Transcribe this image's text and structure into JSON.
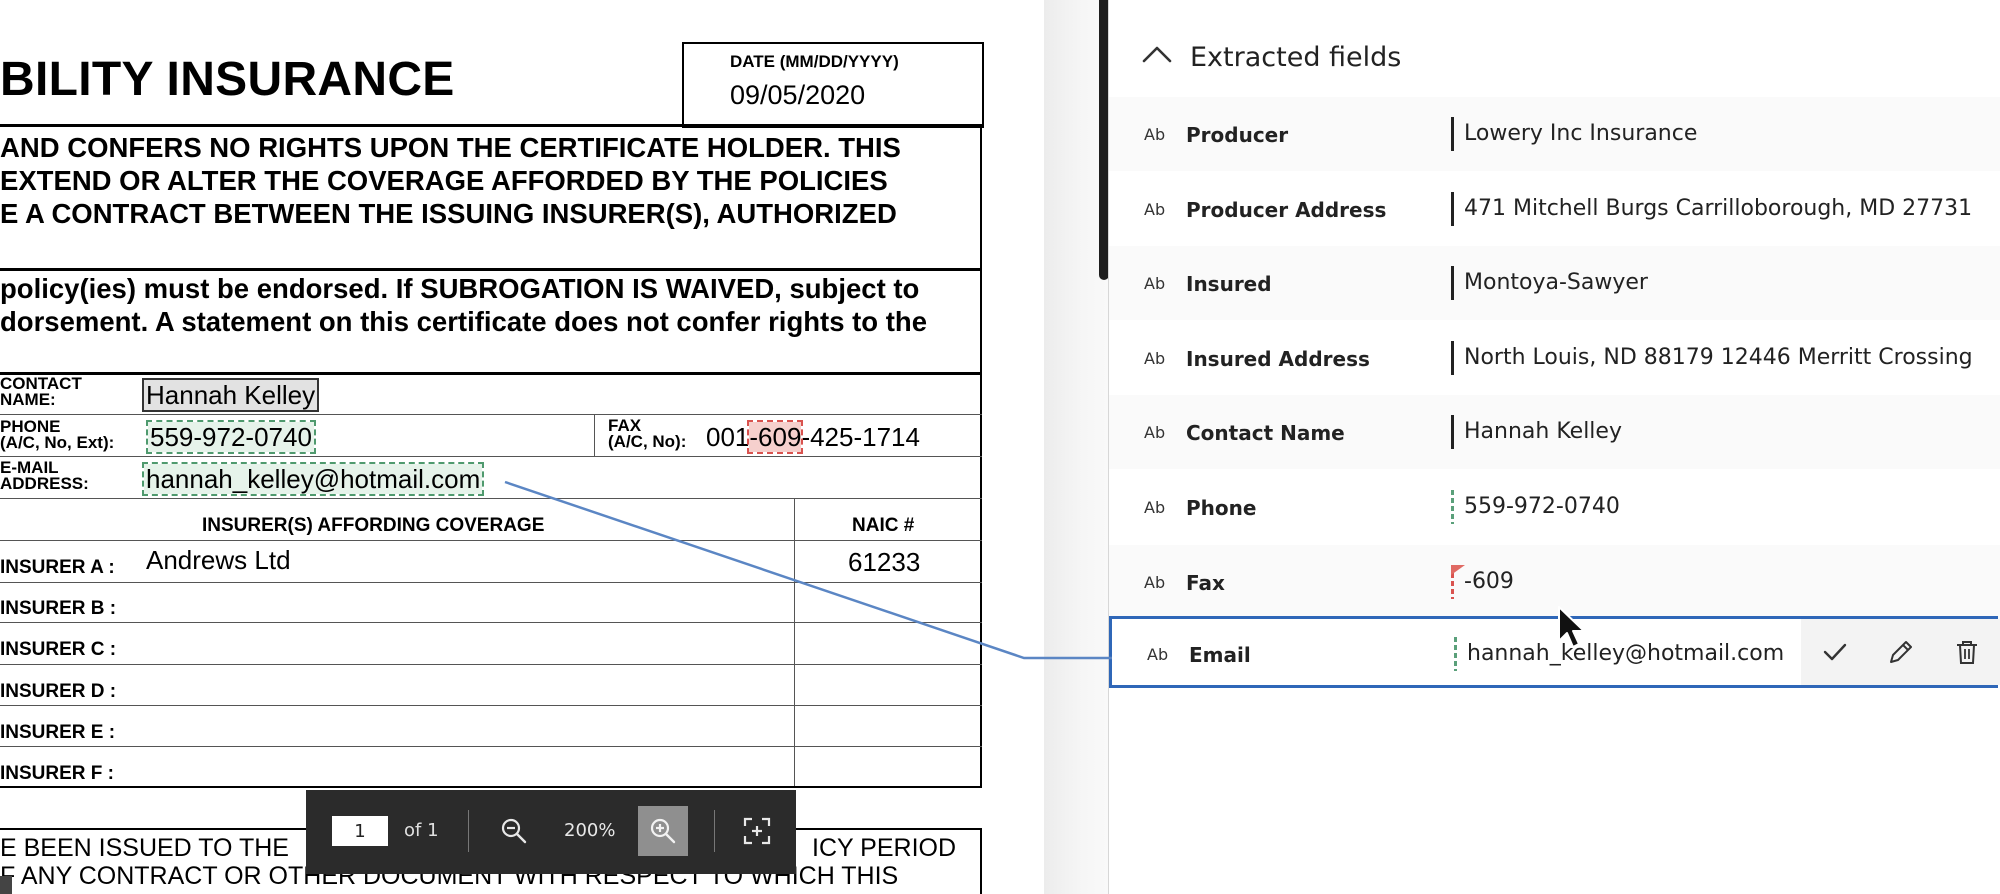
{
  "document": {
    "title": "BILITY INSURANCE",
    "date_label": "DATE (MM/DD/YYYY)",
    "date_value": "09/05/2020",
    "disclaimer_lines": [
      "AND CONFERS NO RIGHTS UPON THE CERTIFICATE HOLDER. THIS",
      "EXTEND OR ALTER THE COVERAGE AFFORDED BY THE POLICIES",
      "E A CONTRACT BETWEEN THE ISSUING INSURER(S), AUTHORIZED"
    ],
    "subrogation_lines": [
      "policy(ies) must be endorsed.  If SUBROGATION IS WAIVED, subject to",
      "dorsement.  A statement on this certificate does not confer rights to the"
    ],
    "contact_label_1": "CONTACT",
    "contact_label_2": "NAME:",
    "contact_value": "Hannah Kelley",
    "phone_label_1": "PHONE",
    "phone_label_2": "(A/C, No, Ext):",
    "phone_value": "559-972-0740",
    "fax_label_1": "FAX",
    "fax_label_2": "(A/C, No):",
    "fax_prefix": "001",
    "fax_highlight": "-609",
    "fax_suffix": "-425-1714",
    "email_label_1": "E-MAIL",
    "email_label_2": "ADDRESS:",
    "email_value": "hannah_kelley@hotmail.com",
    "insurers_header": "INSURER(S) AFFORDING COVERAGE",
    "naic_header": "NAIC #",
    "insurers": [
      {
        "label": "INSURER A :",
        "name": "Andrews Ltd",
        "naic": "61233"
      },
      {
        "label": "INSURER B :",
        "name": "",
        "naic": ""
      },
      {
        "label": "INSURER C :",
        "name": "",
        "naic": ""
      },
      {
        "label": "INSURER D :",
        "name": "",
        "naic": ""
      },
      {
        "label": "INSURER E :",
        "name": "",
        "naic": ""
      },
      {
        "label": "INSURER F :",
        "name": "",
        "naic": ""
      }
    ],
    "bottom_lines": [
      "E BEEN ISSUED TO THE",
      "ICY PERIOD",
      "F ANY CONTRACT OR OTHER DOCUMENT WITH RESPECT TO WHICH THIS"
    ]
  },
  "toolbar": {
    "page_number": "1",
    "page_of": "of 1",
    "zoom_level": "200%",
    "icons": [
      "zoom-out-icon",
      "zoom-in-icon",
      "fit-to-page-icon"
    ]
  },
  "panel": {
    "title": "Extracted fields",
    "type_label": "Ab",
    "fields": [
      {
        "name": "Producer",
        "value": "Lowery Inc Insurance"
      },
      {
        "name": "Producer Address",
        "value": "471 Mitchell Burgs Carrilloborough, MD 27731"
      },
      {
        "name": "Insured",
        "value": "Montoya-Sawyer"
      },
      {
        "name": "Insured Address",
        "value": "North Louis, ND 88179 12446 Merritt Crossing"
      },
      {
        "name": "Contact Name",
        "value": "Hannah Kelley"
      },
      {
        "name": "Phone",
        "value": "559-972-0740"
      },
      {
        "name": "Fax",
        "value": "-609"
      },
      {
        "name": "Email",
        "value": "hannah_kelley@hotmail.com"
      }
    ],
    "email_actions": [
      "check-icon",
      "pencil-icon",
      "trash-icon"
    ]
  },
  "colors": {
    "selection_border": "#2f67b8",
    "match_green": "#5aa07a",
    "mismatch_red": "#d9534f",
    "toolbar_bg": "#2b2b2b"
  }
}
